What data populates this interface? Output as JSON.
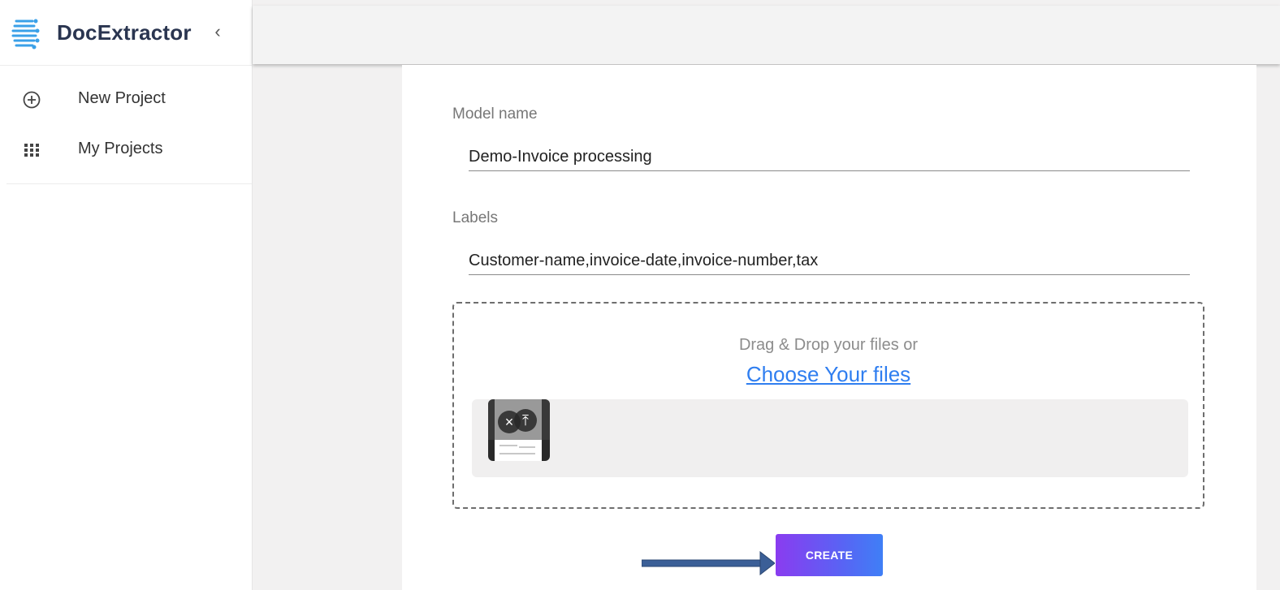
{
  "app": {
    "name": "DocExtractor",
    "collapse_glyph": "‹"
  },
  "sidebar": {
    "items": [
      {
        "label": "New Project",
        "icon": "plus-circle-icon"
      },
      {
        "label": "My Projects",
        "icon": "grid-icon"
      }
    ]
  },
  "form": {
    "model_name_label": "Model name",
    "model_name_value": "Demo-Invoice processing",
    "labels_label": "Labels",
    "labels_value": "Customer-name,invoice-date,invoice-number,tax"
  },
  "upload": {
    "drag_text": "Drag & Drop your files or",
    "choose_link": "Choose Your files",
    "remove_glyph": "×",
    "upload_glyph": "⤒"
  },
  "actions": {
    "create_label": "CREATE"
  },
  "colors": {
    "accent_start": "#8a3cf0",
    "accent_end": "#3f7ff6",
    "link": "#2f7ef0",
    "arrow": "#3b5f97"
  }
}
